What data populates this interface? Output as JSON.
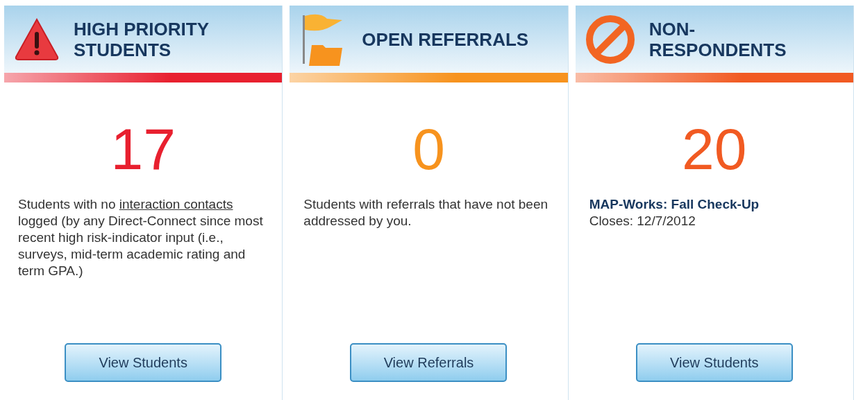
{
  "cards": [
    {
      "kind": "warning",
      "title": [
        "HIGH PRIORITY",
        "STUDENTS"
      ],
      "color": "#e8202f",
      "count": "17",
      "description": [
        {
          "kind": "text",
          "text": "Students with no "
        },
        {
          "kind": "link",
          "text": "interaction contacts"
        },
        {
          "kind": "text",
          "text": " logged (by any Direct-Connect since most recent high risk-indicator input (i.e., surveys, mid-term academic rating and term GPA.)"
        }
      ],
      "button": "View Students"
    },
    {
      "kind": "referral",
      "title": [
        "OPEN REFERRALS"
      ],
      "color": "#f7931e",
      "count": "0",
      "description": [
        {
          "kind": "text",
          "text": "Students with referrals that have not been addressed by you."
        }
      ],
      "button": "View Referrals"
    },
    {
      "kind": "survey",
      "title": [
        "NON-",
        "RESPONDENTS"
      ],
      "color": "#f15a22",
      "count": "20",
      "survey": {
        "name": "MAP-Works: Fall Check-Up",
        "closes": "Closes: 12/7/2012"
      },
      "button": "View Students"
    }
  ]
}
